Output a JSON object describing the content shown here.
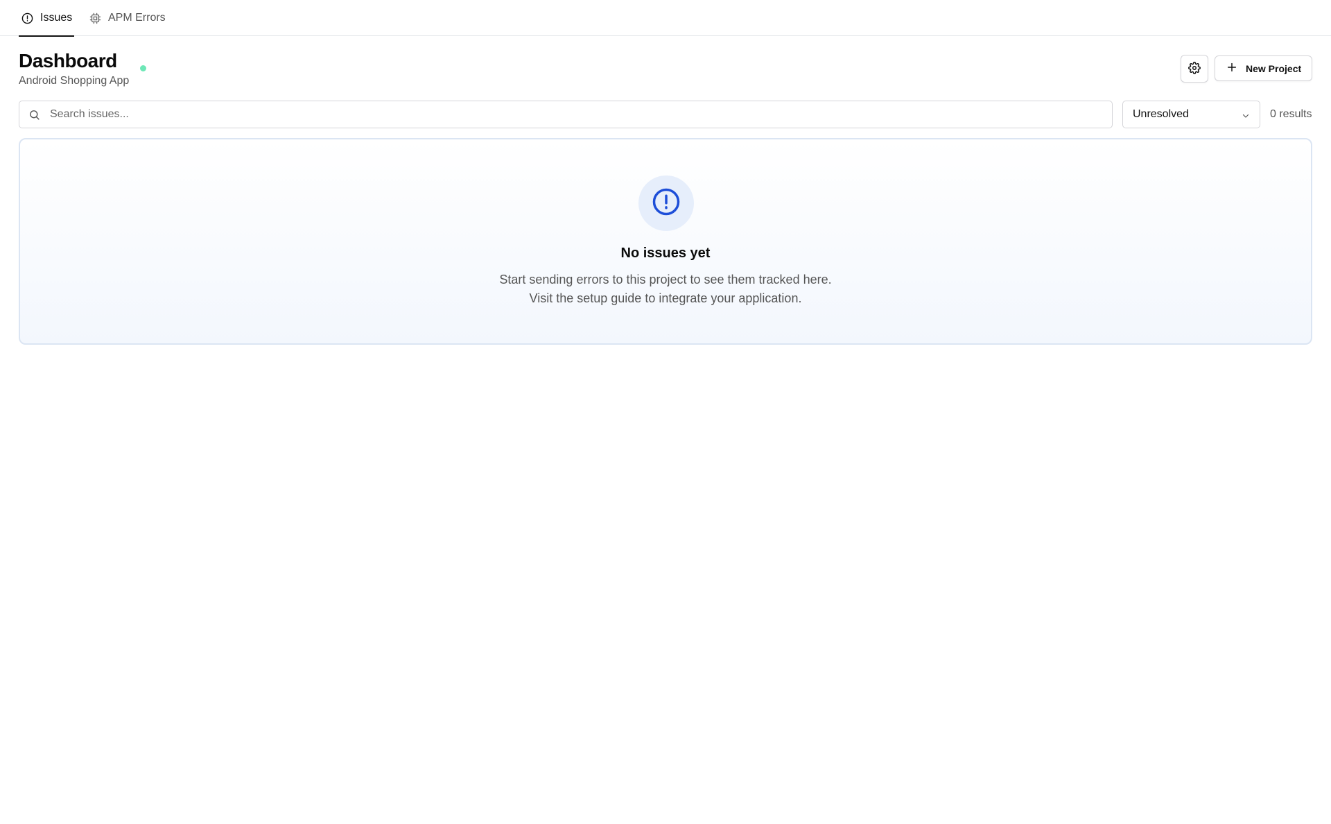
{
  "tabs": [
    {
      "label": "Issues",
      "icon": "alert-circle-icon",
      "active": true
    },
    {
      "label": "APM Errors",
      "icon": "chip-icon",
      "active": false
    }
  ],
  "header": {
    "title": "Dashboard",
    "subtitle": "Android Shopping App",
    "status_color": "#6ee7b7",
    "settings_icon": "gear-icon",
    "new_project_label": "New Project",
    "new_project_icon": "plus-icon"
  },
  "search": {
    "placeholder": "Search issues...",
    "value": "",
    "icon": "search-icon"
  },
  "filter": {
    "selected": "Unresolved",
    "icon": "chevron-down-icon"
  },
  "results": {
    "text": "0 results"
  },
  "empty_state": {
    "icon": "alert-circle-icon",
    "icon_color": "#1d4ed8",
    "title": "No issues yet",
    "line1": "Start sending errors to this project to see them tracked here.",
    "line2": "Visit the setup guide to integrate your application."
  }
}
